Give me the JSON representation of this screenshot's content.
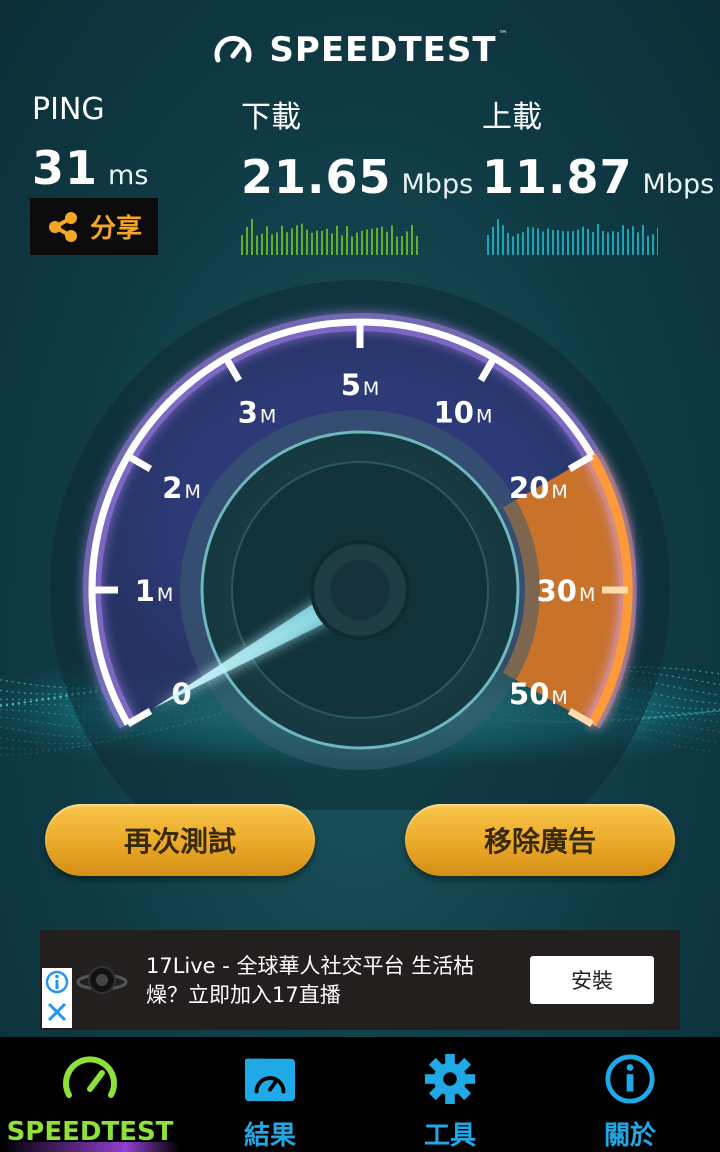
{
  "header": {
    "title": "SPEEDTEST",
    "trademark": "™"
  },
  "stats": {
    "ping": {
      "label": "PING",
      "value": "31",
      "unit": "ms"
    },
    "download": {
      "label": "下載",
      "value": "21.65",
      "unit": "Mbps"
    },
    "upload": {
      "label": "上載",
      "value": "11.87",
      "unit": "Mbps"
    }
  },
  "share": {
    "label": "分享",
    "icon": "share-icon"
  },
  "gauge": {
    "ticks": [
      {
        "num": "0",
        "suffix": ""
      },
      {
        "num": "1",
        "suffix": "M"
      },
      {
        "num": "2",
        "suffix": "M"
      },
      {
        "num": "3",
        "suffix": "M"
      },
      {
        "num": "5",
        "suffix": "M"
      },
      {
        "num": "10",
        "suffix": "M"
      },
      {
        "num": "20",
        "suffix": "M"
      },
      {
        "num": "30",
        "suffix": "M"
      },
      {
        "num": "50",
        "suffix": "M"
      }
    ],
    "current_value_mbps": 0
  },
  "buttons": {
    "retest": "再次測試",
    "remove_ads": "移除廣告"
  },
  "ad": {
    "text_line1": "17Live - 全球華人社交平台 生活枯",
    "text_line2": "燥？立即加入17直播",
    "install": "安裝"
  },
  "nav": [
    {
      "label": "SPEEDTEST",
      "icon": "speedometer-icon",
      "active": true
    },
    {
      "label": "結果",
      "icon": "results-folder-icon",
      "active": false
    },
    {
      "label": "工具",
      "icon": "gear-icon",
      "active": false
    },
    {
      "label": "關於",
      "icon": "info-icon",
      "active": false
    }
  ],
  "colors": {
    "accent_gold": "#eba928",
    "download_green": "#7ed321",
    "upload_cyan": "#23c7d9",
    "nav_blue": "#1fa9e6",
    "nav_active": "#8ee03a",
    "share_orange": "#f5a623"
  }
}
